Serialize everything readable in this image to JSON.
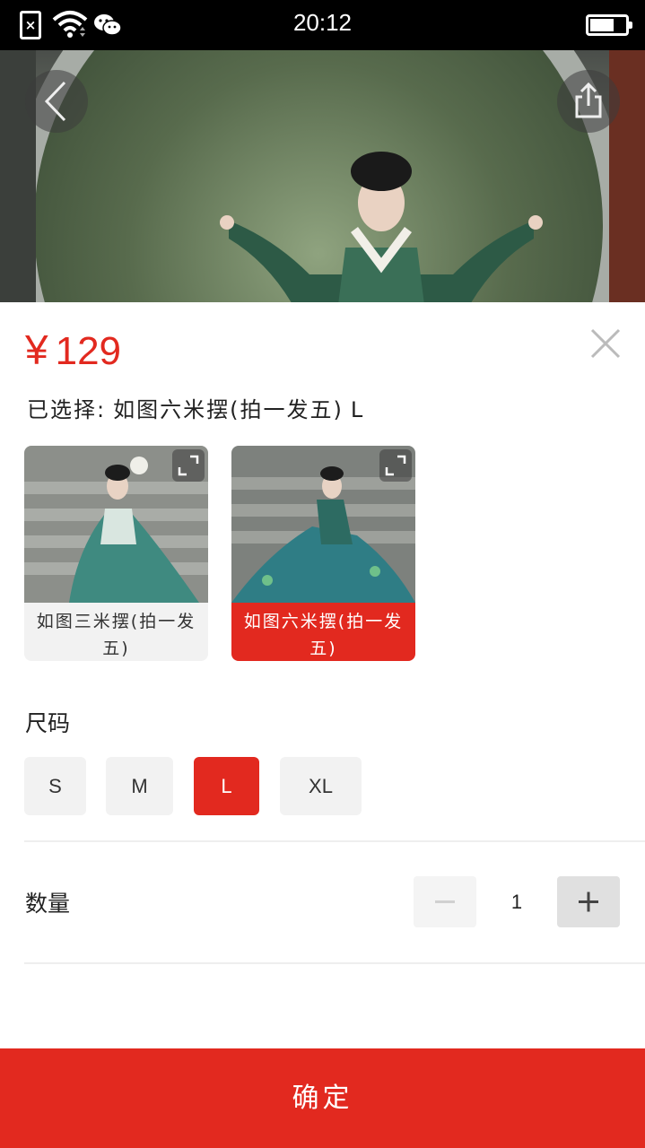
{
  "status_bar": {
    "time": "20:12",
    "icons": [
      "sim-error-icon",
      "wifi-icon",
      "wechat-icon",
      "battery-icon"
    ]
  },
  "hero": {
    "back_icon": "chevron-left-icon",
    "share_icon": "share-icon"
  },
  "product": {
    "currency": "¥",
    "price": "129",
    "selected_prefix": "已选择:",
    "selected_variant": "如图六米摆(拍一发五)",
    "selected_size": "L"
  },
  "variants": [
    {
      "label": "如图三米摆(拍一发五)",
      "selected": false
    },
    {
      "label": "如图六米摆(拍一发五)",
      "selected": true
    }
  ],
  "size": {
    "title": "尺码",
    "options": [
      "S",
      "M",
      "L",
      "XL"
    ],
    "selected": "L"
  },
  "quantity": {
    "title": "数量",
    "value": "1"
  },
  "footer": {
    "confirm_label": "确定"
  },
  "colors": {
    "accent": "#e2291f",
    "chip_bg": "#f2f2f2"
  }
}
